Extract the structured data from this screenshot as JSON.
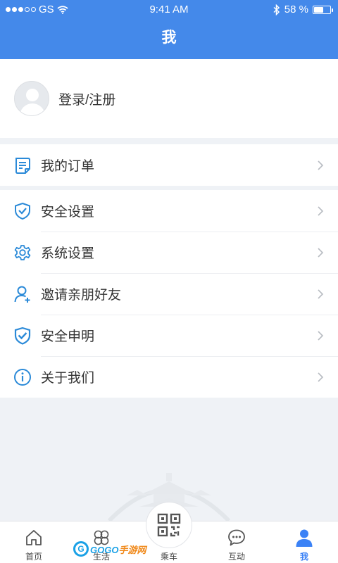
{
  "status_bar": {
    "carrier": "GS",
    "time": "9:41 AM",
    "battery_text": "58 %",
    "battery_level": 0.58,
    "signal_bars_filled": 3,
    "signal_bars_total": 5
  },
  "nav": {
    "title": "我"
  },
  "profile": {
    "login_label": "登录/注册"
  },
  "menu_groups": [
    [
      {
        "label": "我的订单",
        "icon": "order-icon"
      }
    ],
    [
      {
        "label": "安全设置",
        "icon": "shield-icon"
      },
      {
        "label": "系统设置",
        "icon": "gear-icon"
      },
      {
        "label": "邀请亲朋好友",
        "icon": "invite-user-icon"
      },
      {
        "label": "安全申明",
        "icon": "shield-check-icon"
      },
      {
        "label": "关于我们",
        "icon": "info-icon"
      }
    ]
  ],
  "tabbar": {
    "tabs": [
      {
        "label": "首页",
        "icon": "home-icon"
      },
      {
        "label": "生活",
        "icon": "clover-icon"
      },
      {
        "label": "乘车",
        "icon": "qr-code-icon"
      },
      {
        "label": "互动",
        "icon": "chat-icon"
      },
      {
        "label": "我",
        "icon": "person-icon",
        "active": true
      }
    ]
  },
  "watermark": {
    "brand": "GOGO",
    "brand_cn": "手游网"
  },
  "colors": {
    "primary": "#4489ea",
    "accent": "#3b82f6",
    "icon_blue": "#2b8ad8"
  }
}
